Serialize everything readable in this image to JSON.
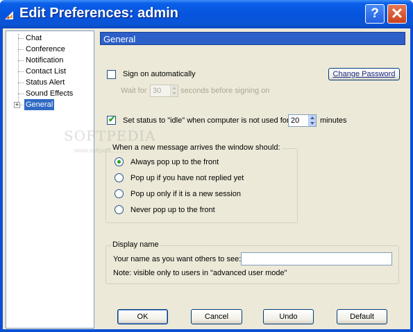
{
  "window": {
    "title": "Edit Preferences: admin",
    "help_glyph": "?",
    "close_glyph": "✕",
    "colors": {
      "titlebar": "#0653dc",
      "selection": "#316ac5",
      "section_header": "#2c5fc8",
      "check_green": "#21a121"
    }
  },
  "tree": {
    "items": [
      {
        "label": "Chat"
      },
      {
        "label": "Conference"
      },
      {
        "label": "Notification"
      },
      {
        "label": "Contact List"
      },
      {
        "label": "Status Alert"
      },
      {
        "label": "Sound Effects"
      },
      {
        "label": "General",
        "selected": true,
        "expander": "+"
      }
    ]
  },
  "watermark": {
    "text": "SOFTPEDIA",
    "sub": "www.softpedia.com"
  },
  "section": {
    "title": "General"
  },
  "signon": {
    "label": "Sign on automatically",
    "checked": false,
    "wait_prefix": "Wait for",
    "wait_value": "30",
    "wait_suffix": "seconds before signing on",
    "change_password": "Change Password"
  },
  "idle": {
    "label": "Set status to \"idle\" when computer is not used for",
    "checked": true,
    "check_glyph": "✔",
    "value": "20",
    "suffix": "minutes"
  },
  "new_message": {
    "title": "When a new message arrives the window should:",
    "options": [
      {
        "label": "Always pop up to the front",
        "selected": true
      },
      {
        "label": "Pop up if you have not replied yet",
        "selected": false
      },
      {
        "label": "Pop up only if it is a new session",
        "selected": false
      },
      {
        "label": "Never pop up to the front",
        "selected": false
      }
    ]
  },
  "display_name": {
    "title": "Display name",
    "prompt": "Your name as you want others to see:",
    "value": "",
    "note": "Note: visible only to users in \"advanced user mode\""
  },
  "buttons": {
    "ok": "OK",
    "cancel": "Cancel",
    "undo": "Undo",
    "default": "Default"
  }
}
